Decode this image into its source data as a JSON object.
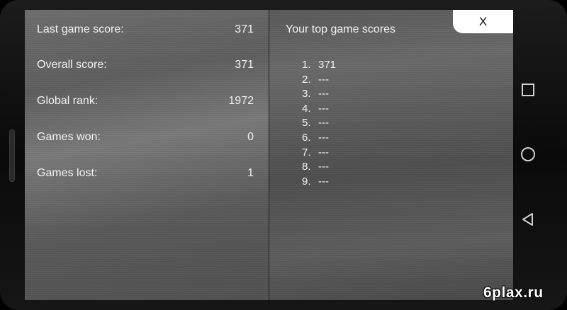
{
  "stats": [
    {
      "label": "Last game score:",
      "value": "371"
    },
    {
      "label": "Overall score:",
      "value": "371"
    },
    {
      "label": "Global rank:",
      "value": "1972"
    },
    {
      "label": "Games won:",
      "value": "0"
    },
    {
      "label": "Games lost:",
      "value": "1"
    }
  ],
  "top_scores": {
    "title": "Your top game scores",
    "items": [
      {
        "rank": "1.",
        "score": "371"
      },
      {
        "rank": "2.",
        "score": "---"
      },
      {
        "rank": "3.",
        "score": "---"
      },
      {
        "rank": "4.",
        "score": "---"
      },
      {
        "rank": "5.",
        "score": "---"
      },
      {
        "rank": "6.",
        "score": "---"
      },
      {
        "rank": "7.",
        "score": "---"
      },
      {
        "rank": "8.",
        "score": "---"
      },
      {
        "rank": "9.",
        "score": "---"
      }
    ]
  },
  "close_label": "X",
  "nav": {
    "recents_icon": "square-icon",
    "home_icon": "circle-icon",
    "back_icon": "triangle-back-icon"
  },
  "watermark": "6plax.ru"
}
